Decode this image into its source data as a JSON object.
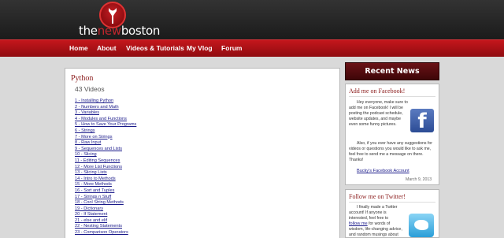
{
  "logo": {
    "prefix": "the",
    "mid": "new",
    "suffix": "boston"
  },
  "nav": [
    "Home",
    "About",
    "Videos & Tutorials",
    "My Vlog",
    "Forum"
  ],
  "content": {
    "title": "Python",
    "count": "43 Videos",
    "videos": [
      "1 - Installing Python",
      "2 - Numbers and Math",
      "3 - Variables",
      "4 - Modules and Functions",
      "5 - How to Save Your Programs",
      "6 - Strings",
      "7 - More on Strings",
      "8 - Raw Input",
      "9 - Sequences and Lists",
      "10 - Slicing",
      "11 - Editing Sequences",
      "12 - More List Functions",
      "13 - Slicing Lists",
      "14 - Intro to Methods",
      "15 - More Methods",
      "16 - Sort and Tuples",
      "17 - Strings n Stuff",
      "18 - Cool String Methods",
      "19 - Dictionary",
      "20 - If Statement",
      "21 - else and elif",
      "22 - Nesting Statements",
      "23 - Comparison Operators"
    ]
  },
  "sidebar": {
    "header": "Recent News",
    "facebook": {
      "title": "Add me on Facebook!",
      "p1": "Hey everyone, make sure to add me on Facebook! I will be posting the podcast schedule, website updates, and maybe even some funny pictures.",
      "p2": "Also, if you ever have any suggestions for videos or questions you would like to ask me, feel free to send me a message on there. Thanks!",
      "link": "Bucky's Facebook Account",
      "date": "March 9, 2013",
      "icon": "facebook-icon"
    },
    "twitter": {
      "title": "Follow me on Twitter!",
      "text_before": "I finally made a Twitter account! If anyone is interested, feel free to",
      "link": "follow me",
      "text_after": "for words of wisdom, life-changing advice, and random musings about fuzzy",
      "icon": "twitter-icon"
    }
  }
}
